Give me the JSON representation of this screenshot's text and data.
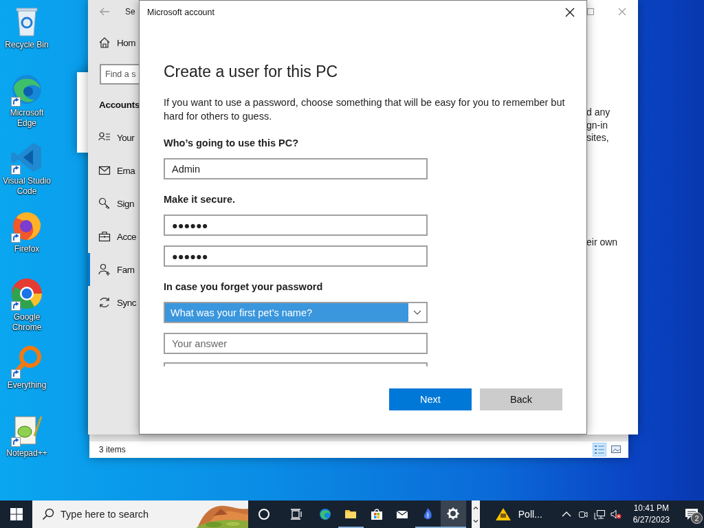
{
  "desktop_icons": [
    {
      "label": "Recycle Bin",
      "kind": "recycle",
      "shortcut": false
    },
    {
      "label": "Microsoft Edge",
      "kind": "edge",
      "shortcut": true
    },
    {
      "label": "Visual Studio Code",
      "kind": "vscode",
      "shortcut": true
    },
    {
      "label": "Firefox",
      "kind": "firefox",
      "shortcut": true
    },
    {
      "label": "Google Chrome",
      "kind": "chrome",
      "shortcut": true
    },
    {
      "label": "Everything",
      "kind": "everything",
      "shortcut": true
    },
    {
      "label": "Notepad++",
      "kind": "notepad",
      "shortcut": true
    }
  ],
  "explorer_window": {
    "status": "3 items",
    "view_buttons": [
      {
        "kind": "details",
        "selected": true
      },
      {
        "kind": "tiles",
        "selected": false
      }
    ]
  },
  "settings_window": {
    "title": "Se",
    "home": "Hom",
    "search_placeholder": "Find a s",
    "section": "Accounts",
    "items": [
      {
        "label": "Your",
        "kind": "info",
        "selected": false
      },
      {
        "label": "Ema",
        "kind": "email",
        "selected": false
      },
      {
        "label": "Sign",
        "kind": "signin",
        "selected": false
      },
      {
        "label": "Acce",
        "kind": "access",
        "selected": false
      },
      {
        "label": "Fam",
        "kind": "family",
        "selected": true
      },
      {
        "label": "Sync",
        "kind": "sync",
        "selected": false
      }
    ],
    "paragraphs": [
      {
        "lines": [
          "d any",
          "gn-in",
          "sites,"
        ]
      },
      {
        "lines": [
          "eir own"
        ]
      }
    ]
  },
  "dialog": {
    "title": "Microsoft account",
    "heading": "Create a user for this PC",
    "intro": "If you want to use a password, choose something that will be easy for you to remember but hard for others to guess.",
    "fields": [
      {
        "kind": "label",
        "text": "Who’s going to use this PC?"
      },
      {
        "kind": "text",
        "value": "Admin"
      },
      {
        "kind": "label",
        "text": "Make it secure."
      },
      {
        "kind": "text",
        "value": "●●●●●●"
      },
      {
        "kind": "text",
        "value": "●●●●●●"
      },
      {
        "kind": "label",
        "text": "In case you forget your password"
      },
      {
        "kind": "dropdown",
        "value": "What was your first pet’s name?",
        "highlighted": true
      },
      {
        "kind": "text",
        "placeholder": "Your answer"
      },
      {
        "kind": "cut"
      }
    ],
    "buttons": [
      {
        "label": "Next",
        "primary": true
      },
      {
        "label": "Back",
        "primary": false
      }
    ]
  },
  "taskbar": {
    "search_placeholder": "Type here to search",
    "apps": [
      {
        "kind": "cortana",
        "running": false,
        "active": false
      },
      {
        "kind": "taskview",
        "running": false,
        "active": false
      },
      {
        "kind": "edge",
        "running": false,
        "active": false
      },
      {
        "kind": "folder",
        "running": true,
        "active": false
      },
      {
        "kind": "store",
        "running": false,
        "active": false
      },
      {
        "kind": "mail",
        "running": false,
        "active": false
      },
      {
        "kind": "flame",
        "running": true,
        "active": false
      },
      {
        "kind": "gear",
        "running": true,
        "active": true
      }
    ],
    "alert": {
      "text": "Poll..."
    },
    "tray": [
      {
        "kind": "chevron"
      },
      {
        "kind": "camera"
      },
      {
        "kind": "network"
      },
      {
        "kind": "volume-muted"
      }
    ],
    "time": "10:41 PM",
    "date": "6/27/2023",
    "notifications": "2"
  }
}
